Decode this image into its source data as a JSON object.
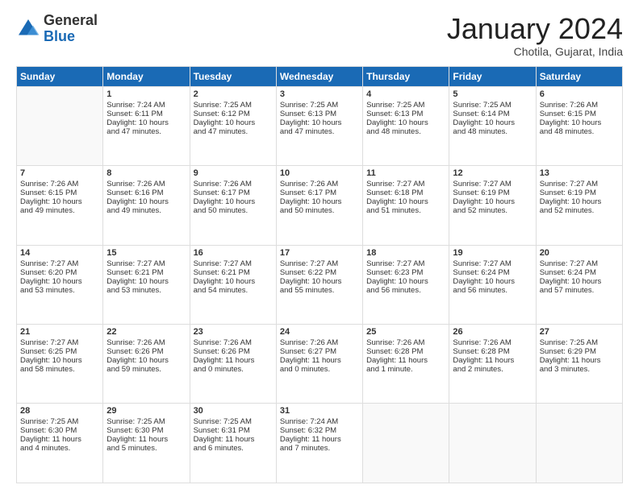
{
  "logo": {
    "general": "General",
    "blue": "Blue"
  },
  "header": {
    "month": "January 2024",
    "location": "Chotila, Gujarat, India"
  },
  "days": [
    "Sunday",
    "Monday",
    "Tuesday",
    "Wednesday",
    "Thursday",
    "Friday",
    "Saturday"
  ],
  "weeks": [
    [
      {
        "num": "",
        "lines": []
      },
      {
        "num": "1",
        "lines": [
          "Sunrise: 7:24 AM",
          "Sunset: 6:11 PM",
          "Daylight: 10 hours",
          "and 47 minutes."
        ]
      },
      {
        "num": "2",
        "lines": [
          "Sunrise: 7:25 AM",
          "Sunset: 6:12 PM",
          "Daylight: 10 hours",
          "and 47 minutes."
        ]
      },
      {
        "num": "3",
        "lines": [
          "Sunrise: 7:25 AM",
          "Sunset: 6:13 PM",
          "Daylight: 10 hours",
          "and 47 minutes."
        ]
      },
      {
        "num": "4",
        "lines": [
          "Sunrise: 7:25 AM",
          "Sunset: 6:13 PM",
          "Daylight: 10 hours",
          "and 48 minutes."
        ]
      },
      {
        "num": "5",
        "lines": [
          "Sunrise: 7:25 AM",
          "Sunset: 6:14 PM",
          "Daylight: 10 hours",
          "and 48 minutes."
        ]
      },
      {
        "num": "6",
        "lines": [
          "Sunrise: 7:26 AM",
          "Sunset: 6:15 PM",
          "Daylight: 10 hours",
          "and 48 minutes."
        ]
      }
    ],
    [
      {
        "num": "7",
        "lines": [
          "Sunrise: 7:26 AM",
          "Sunset: 6:15 PM",
          "Daylight: 10 hours",
          "and 49 minutes."
        ]
      },
      {
        "num": "8",
        "lines": [
          "Sunrise: 7:26 AM",
          "Sunset: 6:16 PM",
          "Daylight: 10 hours",
          "and 49 minutes."
        ]
      },
      {
        "num": "9",
        "lines": [
          "Sunrise: 7:26 AM",
          "Sunset: 6:17 PM",
          "Daylight: 10 hours",
          "and 50 minutes."
        ]
      },
      {
        "num": "10",
        "lines": [
          "Sunrise: 7:26 AM",
          "Sunset: 6:17 PM",
          "Daylight: 10 hours",
          "and 50 minutes."
        ]
      },
      {
        "num": "11",
        "lines": [
          "Sunrise: 7:27 AM",
          "Sunset: 6:18 PM",
          "Daylight: 10 hours",
          "and 51 minutes."
        ]
      },
      {
        "num": "12",
        "lines": [
          "Sunrise: 7:27 AM",
          "Sunset: 6:19 PM",
          "Daylight: 10 hours",
          "and 52 minutes."
        ]
      },
      {
        "num": "13",
        "lines": [
          "Sunrise: 7:27 AM",
          "Sunset: 6:19 PM",
          "Daylight: 10 hours",
          "and 52 minutes."
        ]
      }
    ],
    [
      {
        "num": "14",
        "lines": [
          "Sunrise: 7:27 AM",
          "Sunset: 6:20 PM",
          "Daylight: 10 hours",
          "and 53 minutes."
        ]
      },
      {
        "num": "15",
        "lines": [
          "Sunrise: 7:27 AM",
          "Sunset: 6:21 PM",
          "Daylight: 10 hours",
          "and 53 minutes."
        ]
      },
      {
        "num": "16",
        "lines": [
          "Sunrise: 7:27 AM",
          "Sunset: 6:21 PM",
          "Daylight: 10 hours",
          "and 54 minutes."
        ]
      },
      {
        "num": "17",
        "lines": [
          "Sunrise: 7:27 AM",
          "Sunset: 6:22 PM",
          "Daylight: 10 hours",
          "and 55 minutes."
        ]
      },
      {
        "num": "18",
        "lines": [
          "Sunrise: 7:27 AM",
          "Sunset: 6:23 PM",
          "Daylight: 10 hours",
          "and 56 minutes."
        ]
      },
      {
        "num": "19",
        "lines": [
          "Sunrise: 7:27 AM",
          "Sunset: 6:24 PM",
          "Daylight: 10 hours",
          "and 56 minutes."
        ]
      },
      {
        "num": "20",
        "lines": [
          "Sunrise: 7:27 AM",
          "Sunset: 6:24 PM",
          "Daylight: 10 hours",
          "and 57 minutes."
        ]
      }
    ],
    [
      {
        "num": "21",
        "lines": [
          "Sunrise: 7:27 AM",
          "Sunset: 6:25 PM",
          "Daylight: 10 hours",
          "and 58 minutes."
        ]
      },
      {
        "num": "22",
        "lines": [
          "Sunrise: 7:26 AM",
          "Sunset: 6:26 PM",
          "Daylight: 10 hours",
          "and 59 minutes."
        ]
      },
      {
        "num": "23",
        "lines": [
          "Sunrise: 7:26 AM",
          "Sunset: 6:26 PM",
          "Daylight: 11 hours",
          "and 0 minutes."
        ]
      },
      {
        "num": "24",
        "lines": [
          "Sunrise: 7:26 AM",
          "Sunset: 6:27 PM",
          "Daylight: 11 hours",
          "and 0 minutes."
        ]
      },
      {
        "num": "25",
        "lines": [
          "Sunrise: 7:26 AM",
          "Sunset: 6:28 PM",
          "Daylight: 11 hours",
          "and 1 minute."
        ]
      },
      {
        "num": "26",
        "lines": [
          "Sunrise: 7:26 AM",
          "Sunset: 6:28 PM",
          "Daylight: 11 hours",
          "and 2 minutes."
        ]
      },
      {
        "num": "27",
        "lines": [
          "Sunrise: 7:25 AM",
          "Sunset: 6:29 PM",
          "Daylight: 11 hours",
          "and 3 minutes."
        ]
      }
    ],
    [
      {
        "num": "28",
        "lines": [
          "Sunrise: 7:25 AM",
          "Sunset: 6:30 PM",
          "Daylight: 11 hours",
          "and 4 minutes."
        ]
      },
      {
        "num": "29",
        "lines": [
          "Sunrise: 7:25 AM",
          "Sunset: 6:30 PM",
          "Daylight: 11 hours",
          "and 5 minutes."
        ]
      },
      {
        "num": "30",
        "lines": [
          "Sunrise: 7:25 AM",
          "Sunset: 6:31 PM",
          "Daylight: 11 hours",
          "and 6 minutes."
        ]
      },
      {
        "num": "31",
        "lines": [
          "Sunrise: 7:24 AM",
          "Sunset: 6:32 PM",
          "Daylight: 11 hours",
          "and 7 minutes."
        ]
      },
      {
        "num": "",
        "lines": []
      },
      {
        "num": "",
        "lines": []
      },
      {
        "num": "",
        "lines": []
      }
    ]
  ]
}
